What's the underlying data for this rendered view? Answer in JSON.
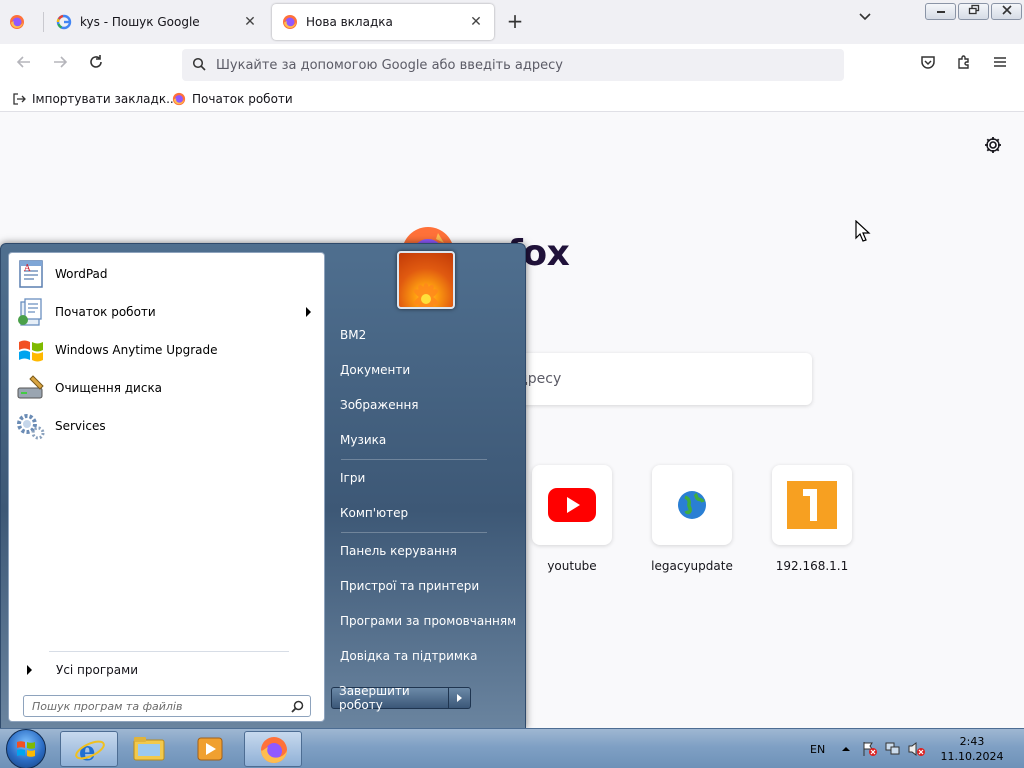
{
  "browser": {
    "tabs": [
      {
        "title": "kys - Пошук Google"
      },
      {
        "title": "Нова вкладка"
      }
    ],
    "urlbar": {
      "placeholder": "Шукайте за допомогою Google або введіть адресу"
    },
    "bookmarks": [
      {
        "label": "Імпортувати закладк..."
      },
      {
        "label": "Початок роботи"
      }
    ]
  },
  "newtab": {
    "brand_word": "refox",
    "search_placeholder": "введіть адресу",
    "shortcuts": [
      {
        "label": "youtube",
        "icon": "youtube-icon"
      },
      {
        "label": "legacyupdate",
        "icon": "globe-icon"
      },
      {
        "label": "192.168.1.1",
        "icon": "number-one-icon"
      }
    ]
  },
  "start_menu": {
    "pinned": [
      {
        "label": "WordPad",
        "icon": "wordpad-icon"
      },
      {
        "label": "Початок роботи",
        "icon": "getting-started-icon",
        "has_submenu": true
      },
      {
        "label": "Windows Anytime Upgrade",
        "icon": "windows-flag-icon"
      },
      {
        "label": "Очищення диска",
        "icon": "disk-cleanup-icon"
      },
      {
        "label": "Services",
        "icon": "services-gear-icon"
      }
    ],
    "all_programs": "Усі програми",
    "search_placeholder": "Пошук програм та файлів",
    "right": {
      "user": "ВМ2",
      "items": [
        "Документи",
        "Зображення",
        "Музика",
        "Ігри",
        "Комп'ютер",
        "Панель керування",
        "Пристрої та принтери",
        "Програми за промовчанням",
        "Довідка та підтримка"
      ]
    },
    "shutdown_label": "Завершити роботу"
  },
  "taskbar": {
    "language": "EN",
    "time": "2:43",
    "date": "11.10.2024"
  },
  "colors": {
    "firefox_orange": "#ff7139",
    "youtube_red": "#ff0000",
    "start_menu_blue": "#3d5876"
  }
}
